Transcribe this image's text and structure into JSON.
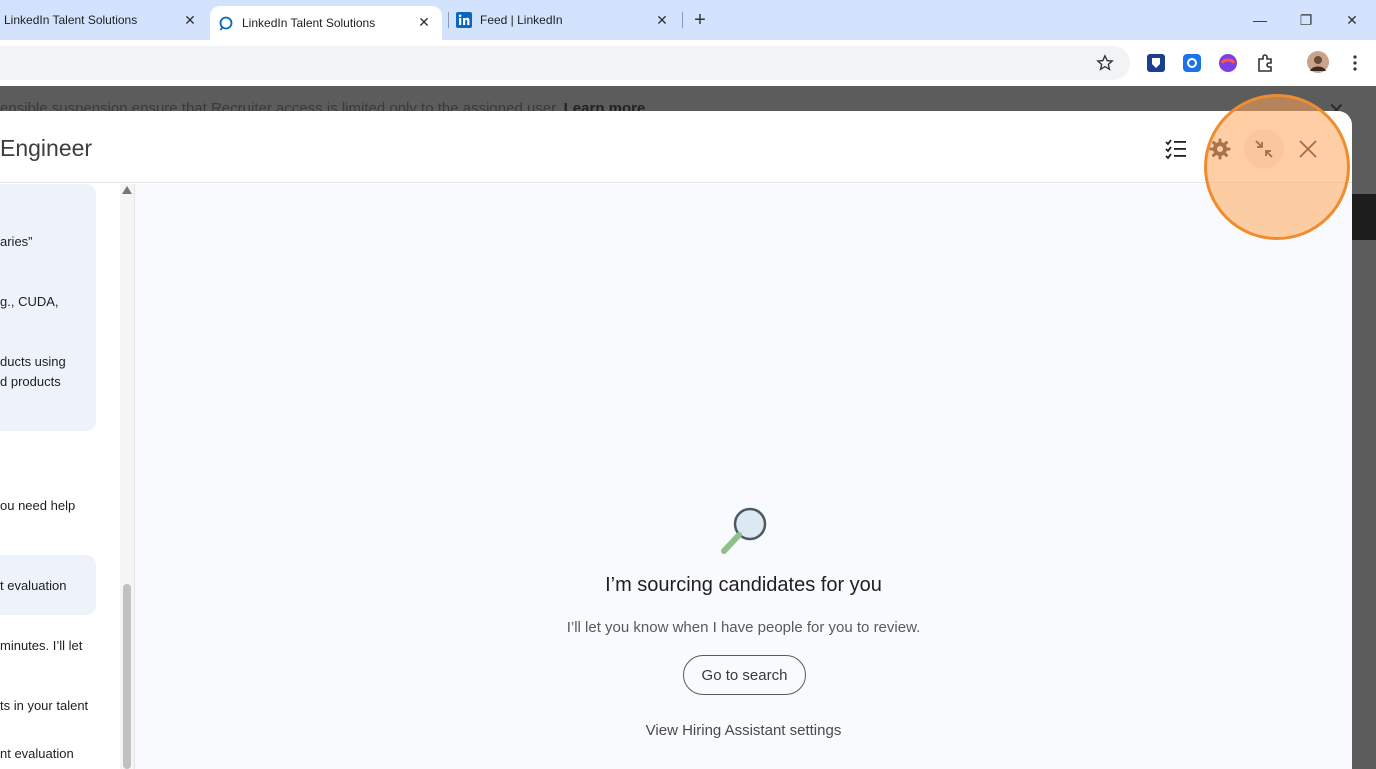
{
  "browser": {
    "tabs": [
      {
        "title": "LinkedIn Talent Solutions",
        "active": false
      },
      {
        "title": "LinkedIn Talent Solutions",
        "active": true
      },
      {
        "title": "Feed | LinkedIn",
        "active": false
      }
    ],
    "tab_close_glyph": "✕",
    "new_tab_glyph": "+",
    "window_controls": {
      "minimize": "—",
      "restore": "❐",
      "close": "✕"
    }
  },
  "banner": {
    "text": "ensible suspension ensure that Recruiter access is limited only to the assigned user. ",
    "link": "Learn more",
    "close_glyph": "✕"
  },
  "modal": {
    "title": "Engineer",
    "header_icons": [
      "checklist-icon",
      "gear-icon",
      "collapse-icon",
      "close-icon"
    ]
  },
  "chat": {
    "lines": [
      "aries”",
      "g., CUDA,",
      "ducts using",
      "d products",
      "ou need help",
      "t evaluation",
      " minutes. I’ll let",
      "ts in your talent",
      "nt evaluation"
    ]
  },
  "main": {
    "title": "I’m sourcing candidates for you",
    "subtitle": "I’ll let you know when I have people for you to review.",
    "go_button": "Go to search",
    "settings_link": "View Hiring Assistant settings"
  },
  "colors": {
    "tabstrip": "#d3e3fd",
    "highlight_ring": "#f08c30",
    "panel_bg": "#f8fafd",
    "chat_shade": "#eef3fb"
  }
}
